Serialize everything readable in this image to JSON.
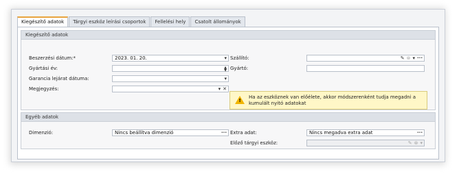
{
  "tabs": [
    {
      "label": "Kiegészítő adatok",
      "active": true
    },
    {
      "label": "Tárgyi eszköz leírási csoportok",
      "active": false
    },
    {
      "label": "Fellelési hely",
      "active": false
    },
    {
      "label": "Csatolt állományok",
      "active": false
    }
  ],
  "group_main": {
    "title": "Kiegészítő adatok",
    "purchase_date": {
      "label": "Beszerzési dátum:*",
      "value": "2023. 01. 20."
    },
    "production_year": {
      "label": "Gyártási év:",
      "value": ""
    },
    "warranty_expiry": {
      "label": "Garancia lejárat dátuma:",
      "value": ""
    },
    "note": {
      "label": "Megjegyzés:",
      "value": ""
    },
    "supplier": {
      "label": "Szállító:",
      "value": ""
    },
    "manufacturer": {
      "label": "Gyártó:",
      "value": ""
    },
    "warning": "Ha az eszköznek van előélete, akkor módszerenként tudja megadni a kumulált nyitó adatokat"
  },
  "group_other": {
    "title": "Egyéb adatok",
    "dimension": {
      "label": "Dimenzió:",
      "value": "Nincs beállítva dimenzió"
    },
    "extra_data": {
      "label": "Extra adat:",
      "value": "Nincs megadva extra adat"
    },
    "prev_asset": {
      "label": "Előző tárgyi eszköz:",
      "value": ""
    }
  },
  "icons": {
    "edit": "pencil-icon",
    "clear": "clear-circle-icon",
    "dropdown": "chevron-down-icon",
    "more": "ellipsis-icon",
    "close": "close-x-icon",
    "warning": "warning-triangle-icon"
  },
  "colors": {
    "active_tab_accent": "#e8a33d",
    "warning_bg": "#fff7c7",
    "warning_icon": "#f0b400"
  }
}
